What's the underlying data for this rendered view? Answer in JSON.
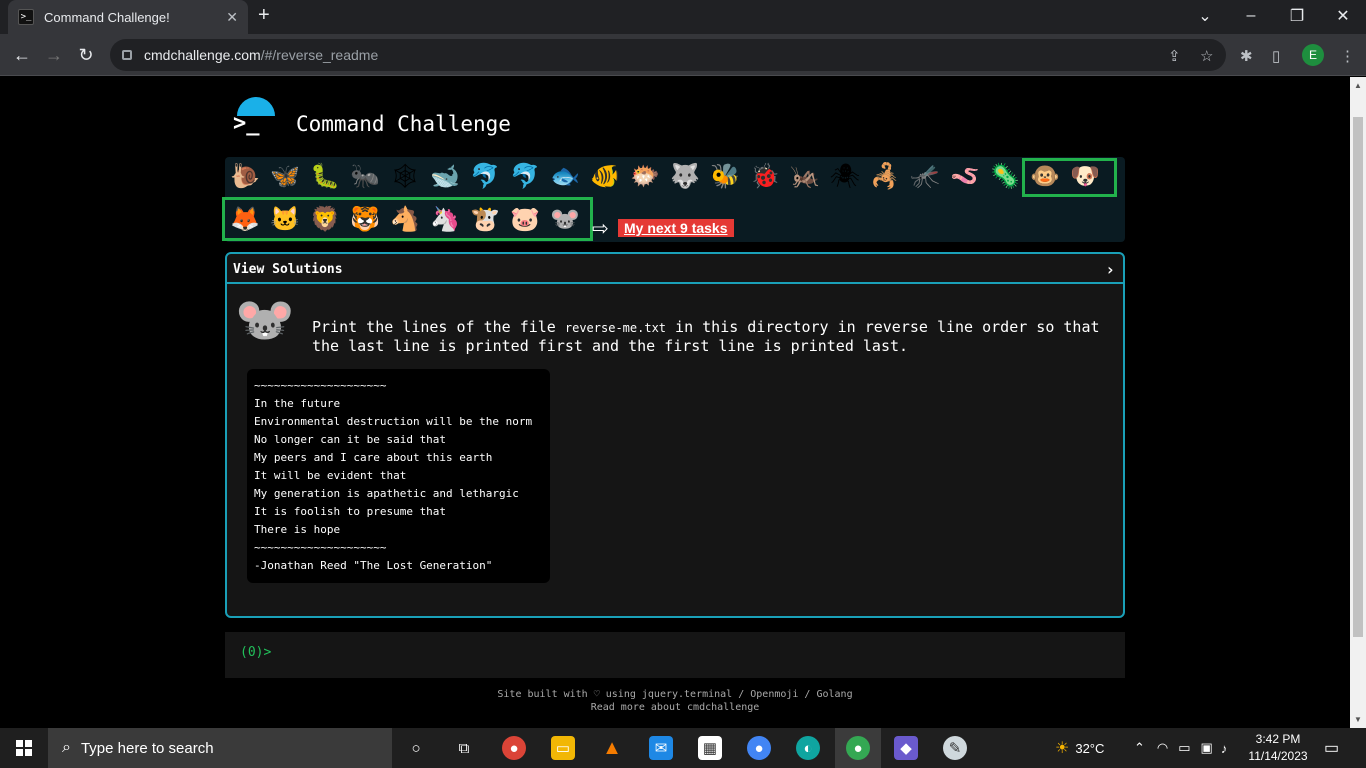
{
  "browser": {
    "tab_title": "Command Challenge!",
    "tab_close": "✕",
    "new_tab": "+",
    "url_host": "cmdchallenge.com",
    "url_rest": "/#/reverse_readme",
    "profile_initial": "E"
  },
  "site": {
    "title": "Command Challenge",
    "prompt_glyph": ">_",
    "next_tasks": "My next 9 tasks",
    "view_solutions": "View Solutions",
    "task_prefix": "Print the lines of the file ",
    "task_file": "reverse-me.txt",
    "task_suffix": " in this directory in reverse line order so that the last line is printed first and the first line is printed last.",
    "poem": "~~~~~~~~~~~~~~~~~~~~\nIn the future\nEnvironmental destruction will be the norm\nNo longer can it be said that\nMy peers and I care about this earth\nIt will be evident that\nMy generation is apathetic and lethargic\nIt is foolish to presume that\nThere is hope\n~~~~~~~~~~~~~~~~~~~~\n-Jonathan Reed \"The Lost Generation\"",
    "terminal_prompt": "(0)>",
    "footer_line1": "Site built with ♡ using jquery.terminal / Openmoji / Golang",
    "footer_line2": "Read more about cmdchallenge"
  },
  "animals_row1": [
    "🐌",
    "🦋",
    "🐛",
    "🐜",
    "🕸",
    "🐋",
    "🐬",
    "🐬",
    "🐟",
    "🐠",
    "🐡",
    "🐺",
    "🐝",
    "🐞",
    "🦗",
    "🕷",
    "🦂",
    "🦟",
    "🪱",
    "🦠",
    "🐵",
    "🐶"
  ],
  "animals_row2": [
    "🦊",
    "🐱",
    "🦁",
    "🐯",
    "🐴",
    "🦄",
    "🐮",
    "🐷",
    "🐭"
  ],
  "mouse_icon": "🐭",
  "taskbar": {
    "search_placeholder": "Type here to search",
    "weather": "32°C",
    "time": "3:42 PM",
    "date": "11/14/2023"
  }
}
